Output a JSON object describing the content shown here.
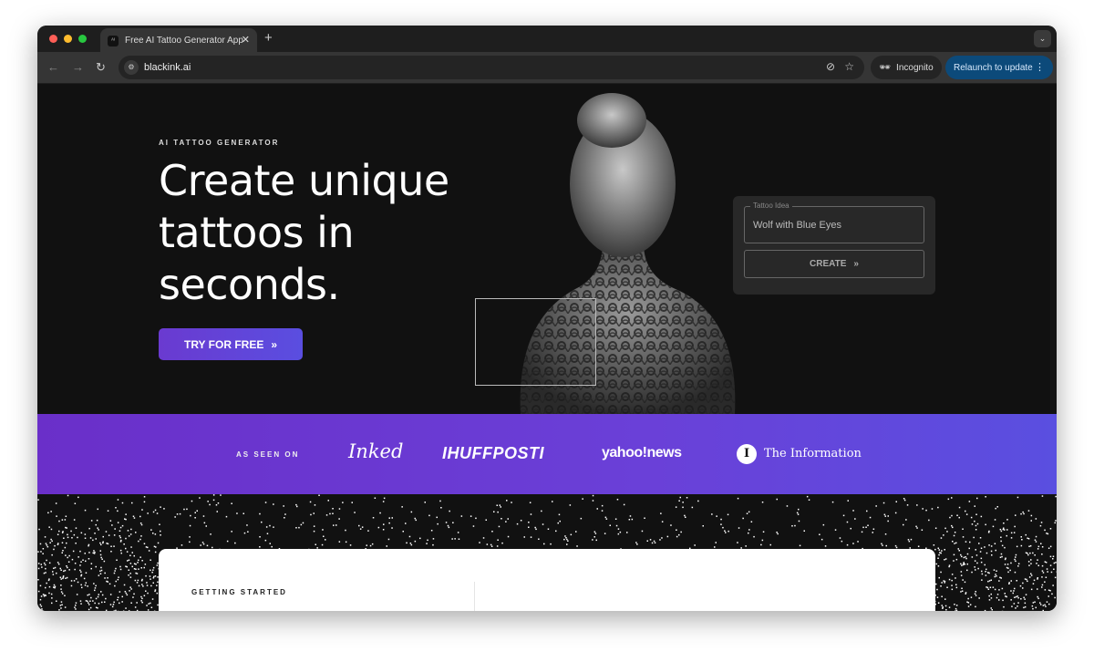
{
  "browser": {
    "tab_title": "Free AI Tattoo Generator App",
    "favicon_text": "ᴬᴵ",
    "url": "blackink.ai",
    "incognito_label": "Incognito",
    "relaunch_label": "Relaunch to update"
  },
  "hero": {
    "eyebrow": "AI TATTOO GENERATOR",
    "headline": "Create unique tattoos in seconds.",
    "cta_label": "TRY FOR FREE",
    "cta_color": "#6a3ad0"
  },
  "generator": {
    "field_label": "Tattoo Idea",
    "field_value": "Wolf with Blue Eyes",
    "create_label": "CREATE"
  },
  "press": {
    "label": "AS SEEN ON",
    "logos": [
      "Inked",
      "IHUFFPOSTI",
      "yahoo!news",
      "The Information"
    ],
    "info_icon_letter": "I"
  },
  "section": {
    "title": "GETTING STARTED"
  }
}
